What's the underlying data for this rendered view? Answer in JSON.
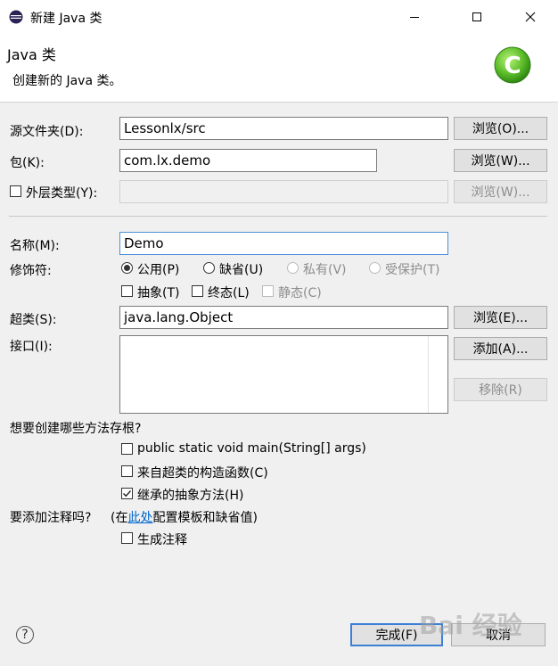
{
  "window": {
    "title": "新建 Java 类",
    "controls": {
      "minimize_icon": "minimize-icon",
      "maximize_icon": "maximize-icon",
      "close_icon": "close-icon"
    }
  },
  "header": {
    "title": "Java 类",
    "description": "创建新的 Java 类。",
    "logo_icon": "new-class-c-icon",
    "logo_color": "#5fbf2a"
  },
  "form": {
    "source_folder": {
      "label": "源文件夹(D):",
      "value": "Lessonlx/src",
      "browse": "浏览(O)..."
    },
    "package": {
      "label": "包(K):",
      "value": "com.lx.demo",
      "browse": "浏览(W)..."
    },
    "enclosing": {
      "label": "外层类型(Y):",
      "value": "",
      "browse": "浏览(W)...",
      "checked": false
    },
    "name": {
      "label": "名称(M):",
      "value": "Demo"
    },
    "modifiers": {
      "label": "修饰符:",
      "access": [
        {
          "label": "公用(P)",
          "selected": true,
          "enabled": true
        },
        {
          "label": "缺省(U)",
          "selected": false,
          "enabled": true
        },
        {
          "label": "私有(V)",
          "selected": false,
          "enabled": false
        },
        {
          "label": "受保护(T)",
          "selected": false,
          "enabled": false
        }
      ],
      "flags": [
        {
          "label": "抽象(T)",
          "checked": false,
          "enabled": true
        },
        {
          "label": "终态(L)",
          "checked": false,
          "enabled": true
        },
        {
          "label": "静态(C)",
          "checked": false,
          "enabled": false
        }
      ]
    },
    "superclass": {
      "label": "超类(S):",
      "value": "java.lang.Object",
      "browse": "浏览(E)..."
    },
    "interfaces": {
      "label": "接口(I):",
      "add": "添加(A)...",
      "remove": "移除(R)"
    },
    "stubs": {
      "question": "想要创建哪些方法存根?",
      "options": [
        {
          "label": "public static void main(String[] args)",
          "checked": false
        },
        {
          "label": "来自超类的构造函数(C)",
          "checked": false
        },
        {
          "label": "继承的抽象方法(H)",
          "checked": true
        }
      ]
    },
    "comments": {
      "question": "要添加注释吗?",
      "hint_prefix": "(在",
      "hint_link": "此处",
      "hint_suffix": "配置模板和缺省值)",
      "generate": {
        "label": "生成注释",
        "checked": false
      }
    }
  },
  "footer": {
    "help_icon": "help-icon",
    "finish": "完成(F)",
    "cancel": "取消"
  },
  "watermark": "Bai 经验"
}
